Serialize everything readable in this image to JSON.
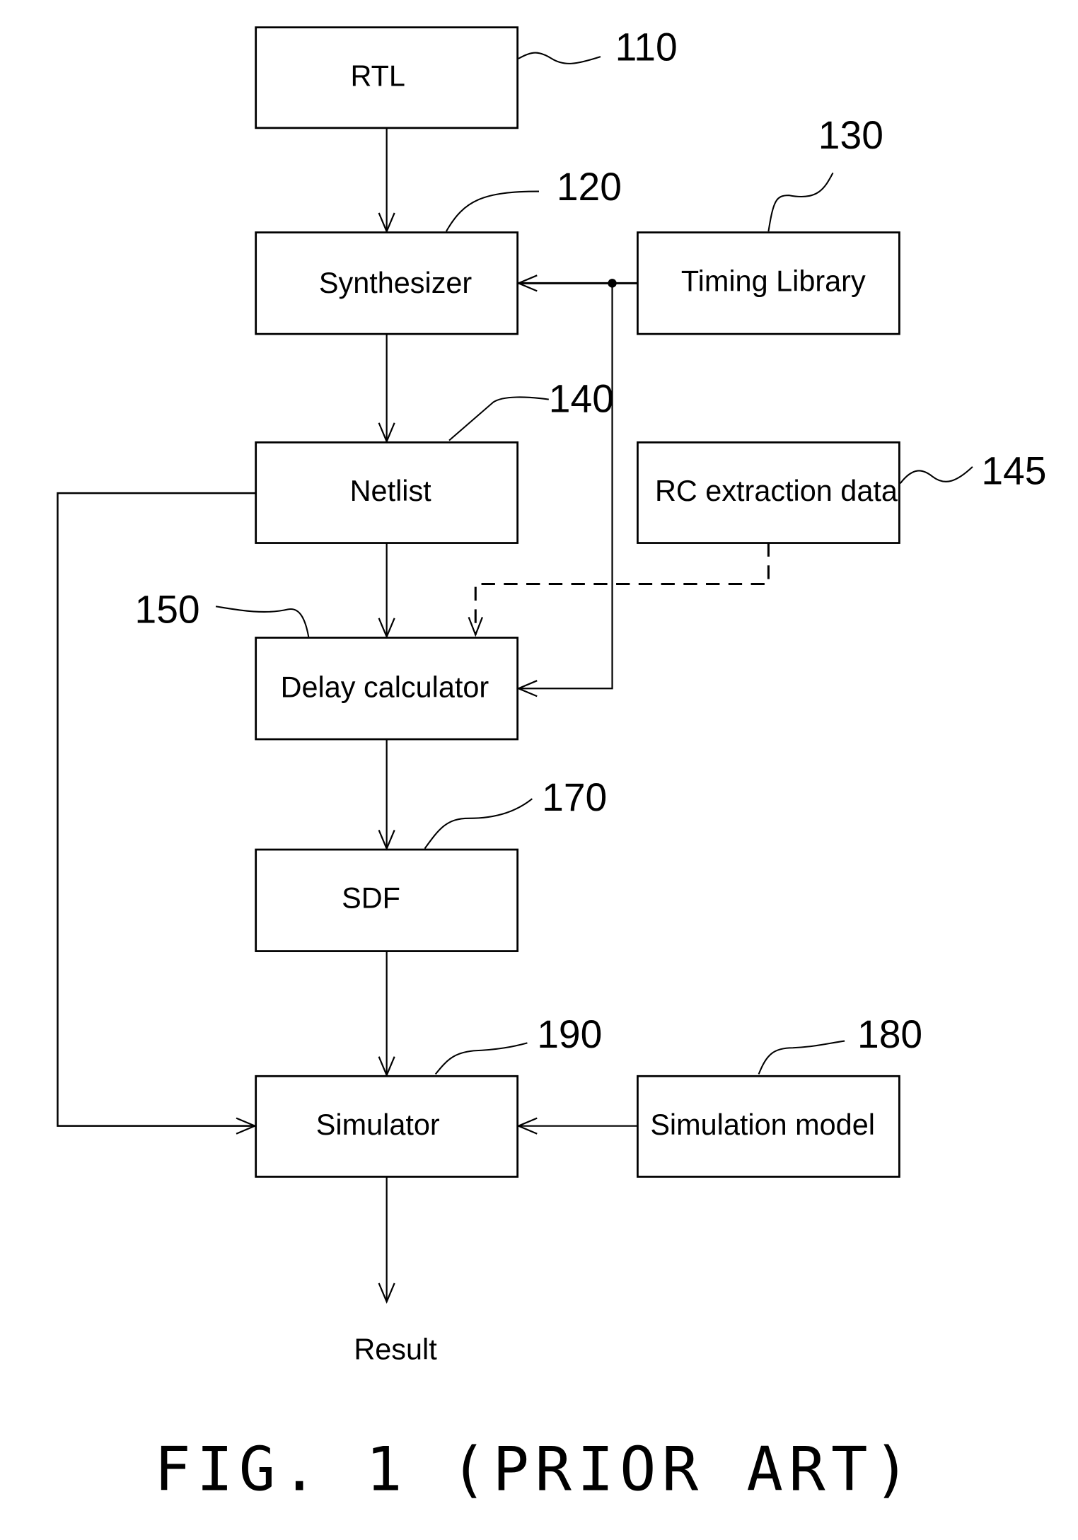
{
  "figure": {
    "caption": "FIG. 1 (PRIOR ART)",
    "blocks": {
      "rtl": {
        "label": "RTL",
        "ref": "110"
      },
      "synthesizer": {
        "label": "Synthesizer",
        "ref": "120"
      },
      "timing_library": {
        "label": "Timing Library",
        "ref": "130"
      },
      "netlist": {
        "label": "Netlist",
        "ref": "140"
      },
      "rc_extraction": {
        "label": "RC extraction data",
        "ref": "145"
      },
      "delay_calculator": {
        "label": "Delay calculator",
        "ref": "150"
      },
      "sdf": {
        "label": "SDF",
        "ref": "170"
      },
      "simulation_model": {
        "label": "Simulation model",
        "ref": "180"
      },
      "simulator": {
        "label": "Simulator",
        "ref": "190"
      }
    },
    "output_label": "Result",
    "connections": [
      {
        "from": "RTL",
        "to": "Synthesizer",
        "style": "solid"
      },
      {
        "from": "Timing Library",
        "to": "Synthesizer",
        "style": "solid"
      },
      {
        "from": "Timing Library",
        "to": "Delay calculator",
        "style": "solid"
      },
      {
        "from": "Synthesizer",
        "to": "Netlist",
        "style": "solid"
      },
      {
        "from": "Netlist",
        "to": "Delay calculator",
        "style": "solid"
      },
      {
        "from": "Netlist",
        "to": "Simulator",
        "style": "solid"
      },
      {
        "from": "RC extraction data",
        "to": "Delay calculator",
        "style": "dashed"
      },
      {
        "from": "Delay calculator",
        "to": "SDF",
        "style": "solid"
      },
      {
        "from": "SDF",
        "to": "Simulator",
        "style": "solid"
      },
      {
        "from": "Simulation model",
        "to": "Simulator",
        "style": "solid"
      },
      {
        "from": "Simulator",
        "to": "Result",
        "style": "solid"
      }
    ]
  }
}
